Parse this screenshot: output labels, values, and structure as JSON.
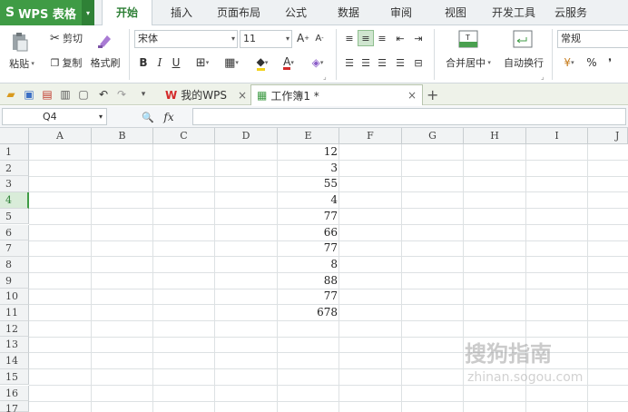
{
  "app": {
    "logo": "S",
    "name": "WPS 表格",
    "caret": "▾"
  },
  "menu": [
    "开始",
    "插入",
    "页面布局",
    "公式",
    "数据",
    "审阅",
    "视图",
    "开发工具",
    "云服务"
  ],
  "ribbon": {
    "paste": "粘贴",
    "cut": "剪切",
    "copy": "复制",
    "format_painter": "格式刷",
    "font_name": "宋体",
    "font_size": "11",
    "bold": "B",
    "italic": "I",
    "underline": "U",
    "merge_center": "合并居中",
    "wrap_text": "自动换行",
    "number_format": "常规",
    "percent": "%",
    "comma": "❜"
  },
  "doc_tabs": {
    "my_wps": "我的WPS",
    "workbook": "工作簿1 *",
    "close": "×",
    "new": "+"
  },
  "formula_bar": {
    "name_box": "Q4",
    "zoom_icon": "🔍",
    "fx": "fx"
  },
  "columns": [
    "A",
    "B",
    "C",
    "D",
    "E",
    "F",
    "G",
    "H",
    "I",
    "J"
  ],
  "rows": [
    "1",
    "2",
    "3",
    "4",
    "5",
    "6",
    "7",
    "8",
    "9",
    "10",
    "11",
    "12",
    "13",
    "14",
    "15",
    "16",
    "17"
  ],
  "active_row": "4",
  "column_e_values": [
    "12",
    "3",
    "55",
    "4",
    "77",
    "66",
    "77",
    "8",
    "88",
    "77",
    "678"
  ],
  "watermark": {
    "main": "搜狗指南",
    "sub": "zhinan.sogou.com"
  },
  "colors": {
    "brand_green": "#3f9b45"
  }
}
